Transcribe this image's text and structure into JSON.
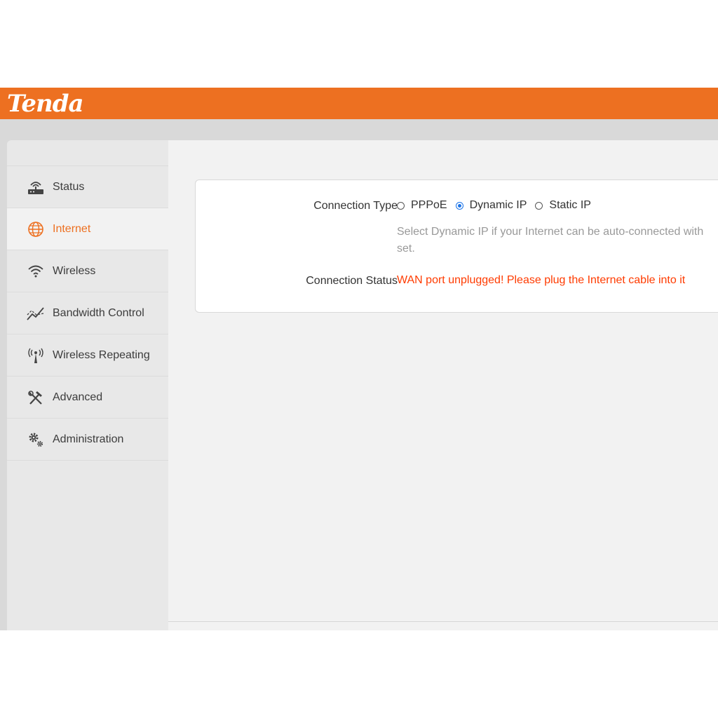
{
  "brand": {
    "logo_text": "Tenda",
    "accent_color": "#ed7021"
  },
  "sidebar": {
    "items": [
      {
        "label": "Status",
        "icon": "router-icon",
        "active": false
      },
      {
        "label": "Internet",
        "icon": "globe-icon",
        "active": true
      },
      {
        "label": "Wireless",
        "icon": "wifi-icon",
        "active": false
      },
      {
        "label": "Bandwidth Control",
        "icon": "bandwidth-icon",
        "active": false
      },
      {
        "label": "Wireless Repeating",
        "icon": "antenna-icon",
        "active": false
      },
      {
        "label": "Advanced",
        "icon": "tools-icon",
        "active": false
      },
      {
        "label": "Administration",
        "icon": "gears-icon",
        "active": false
      }
    ]
  },
  "internet": {
    "connection_type_label": "Connection Type",
    "options": [
      {
        "label": "PPPoE",
        "checked": false
      },
      {
        "label": "Dynamic IP",
        "checked": true
      },
      {
        "label": "Static IP",
        "checked": false
      }
    ],
    "hint_line1": "Select Dynamic IP if your Internet can be auto-connected with",
    "hint_line2": "set.",
    "connection_status_label": "Connection Status",
    "connection_status_value": "WAN port unplugged! Please plug the Internet cable into it",
    "status_color": "#ff3b00"
  }
}
